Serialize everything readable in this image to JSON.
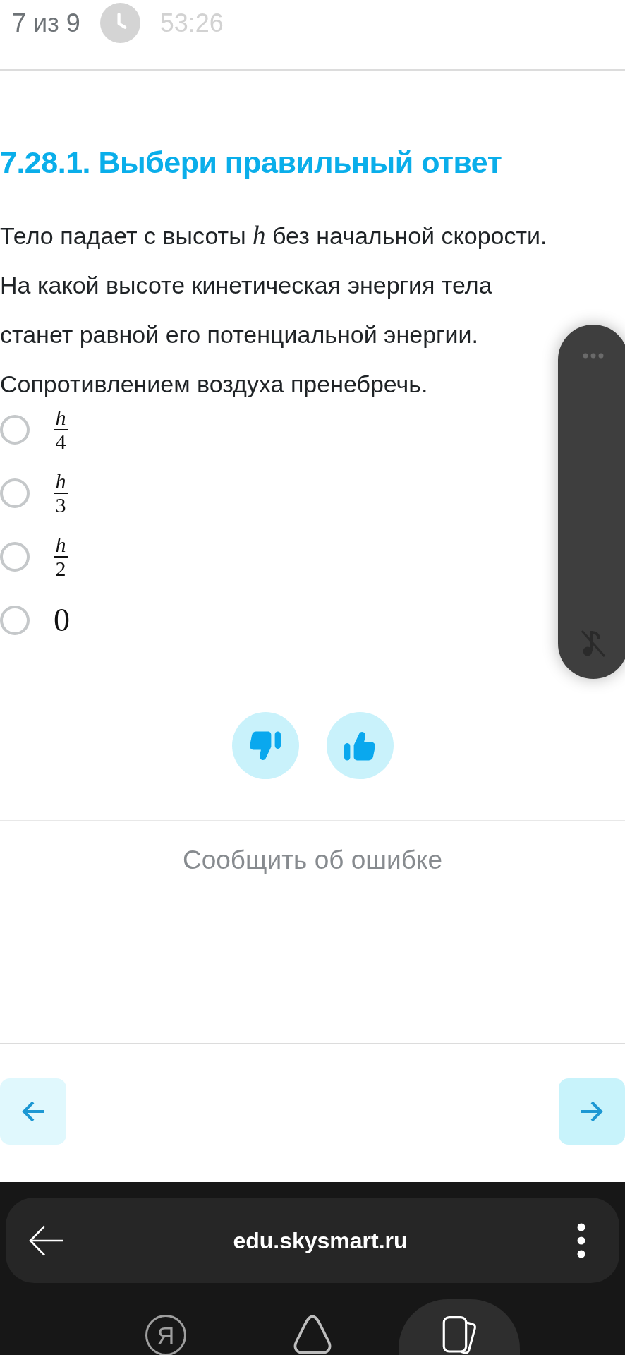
{
  "header": {
    "progress": "7 из 9",
    "timer": "53:26"
  },
  "task": {
    "title": "7.28.1. Выбери правильный ответ",
    "question": [
      "Тело падает с высоты *h* без начальной скорости.",
      "На какой высоте кинетическая энергия тела станет равной его потенциальной энергии.",
      "Сопротивлением воздуха пренебречь."
    ]
  },
  "options": [
    {
      "kind": "fraction",
      "numerator": "h",
      "denominator": "4",
      "selected": false
    },
    {
      "kind": "fraction",
      "numerator": "h",
      "denominator": "3",
      "selected": false
    },
    {
      "kind": "fraction",
      "numerator": "h",
      "denominator": "2",
      "selected": false
    },
    {
      "kind": "number",
      "text": "0",
      "selected": false
    }
  ],
  "report_link": "Сообщить об ошибке",
  "browser": {
    "url": "edu.skysmart.ru",
    "bottom_nav": [
      {
        "kind": "logo",
        "label": "Я",
        "selected": false
      },
      {
        "kind": "assistant",
        "selected": false
      },
      {
        "kind": "tabs",
        "selected": true
      }
    ]
  }
}
